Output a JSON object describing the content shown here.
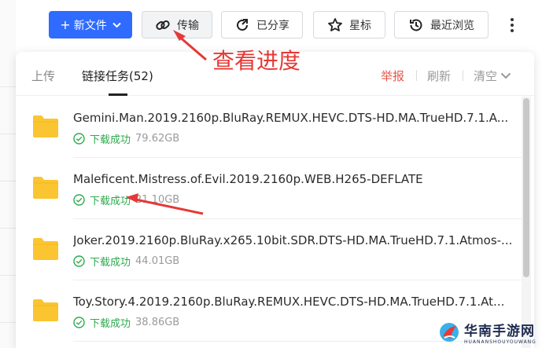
{
  "toolbar": {
    "new_file_label": "新文件",
    "transfer_label": "传输",
    "shared_label": "已分享",
    "star_label": "星标",
    "recent_label": "最近浏览"
  },
  "annotation": {
    "text": "查看进度"
  },
  "panel": {
    "tabs": [
      {
        "label": "上传"
      },
      {
        "label": "链接任务(52)"
      }
    ],
    "actions": {
      "report": "举报",
      "refresh": "刷新",
      "clear": "清空"
    }
  },
  "tasks": [
    {
      "name": "Gemini.Man.2019.2160p.BluRay.REMUX.HEVC.DTS-HD.MA.TrueHD.7.1.A...",
      "status": "下载成功",
      "size": "79.62GB"
    },
    {
      "name": "Maleficent.Mistress.of.Evil.2019.2160p.WEB.H265-DEFLATE",
      "status": "下载成功",
      "size": "21.10GB"
    },
    {
      "name": "Joker.2019.2160p.BluRay.x265.10bit.SDR.DTS-HD.MA.TrueHD.7.1.Atmos-...",
      "status": "下载成功",
      "size": "44.01GB"
    },
    {
      "name": "Toy.Story.4.2019.2160p.BluRay.REMUX.HEVC.DTS-HD.MA.TrueHD.7.1.At...",
      "status": "下载成功",
      "size": "38.86GB"
    }
  ],
  "watermark": {
    "main": "华南手游网",
    "sub": "HUANANSHOUYOUWANG"
  },
  "colors": {
    "primary": "#2f6bff",
    "success": "#2eaa4f",
    "report": "#e8584a",
    "annotation": "#e53935",
    "folder": "#fbc531"
  }
}
